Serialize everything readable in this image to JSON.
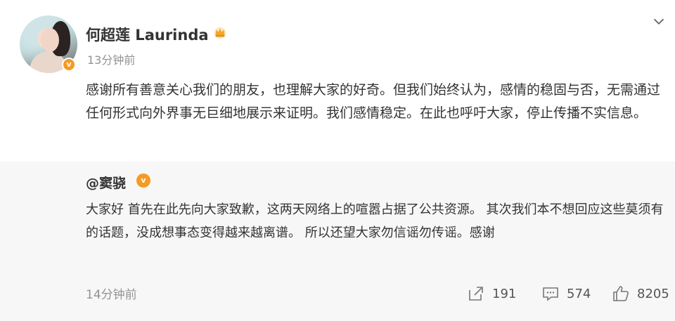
{
  "post": {
    "username": "何超莲 Laurinda",
    "time": "13分钟前",
    "content": "感谢所有善意关心我们的朋友，也理解大家的好奇。但我们始终认为，感情的稳固与否，无需通过任何形式向外界事无巨细地展示来证明。我们感情稳定。在此也呼吁大家，停止传播不实信息。"
  },
  "repost": {
    "author": "@窦骁",
    "content": "大家好 首先在此先向大家致歉，这两天网络上的喧嚣占据了公共资源。 其次我们本不想回应这些莫须有的话题，没成想事态变得越来越离谱。 所以还望大家勿信谣勿传谣。感谢",
    "time": "14分钟前"
  },
  "actions": {
    "repost_count": "191",
    "comment_count": "574",
    "like_count": "8205"
  },
  "icons": {
    "verified_badge": "verified-v-icon",
    "crown": "crown-icon",
    "more": "chevron-down-icon",
    "repost": "repost-icon",
    "comment": "comment-icon",
    "like": "thumbs-up-icon"
  },
  "colors": {
    "accent": "#f59a23",
    "muted_text": "#939393",
    "repost_bg": "#f7f7f7"
  }
}
